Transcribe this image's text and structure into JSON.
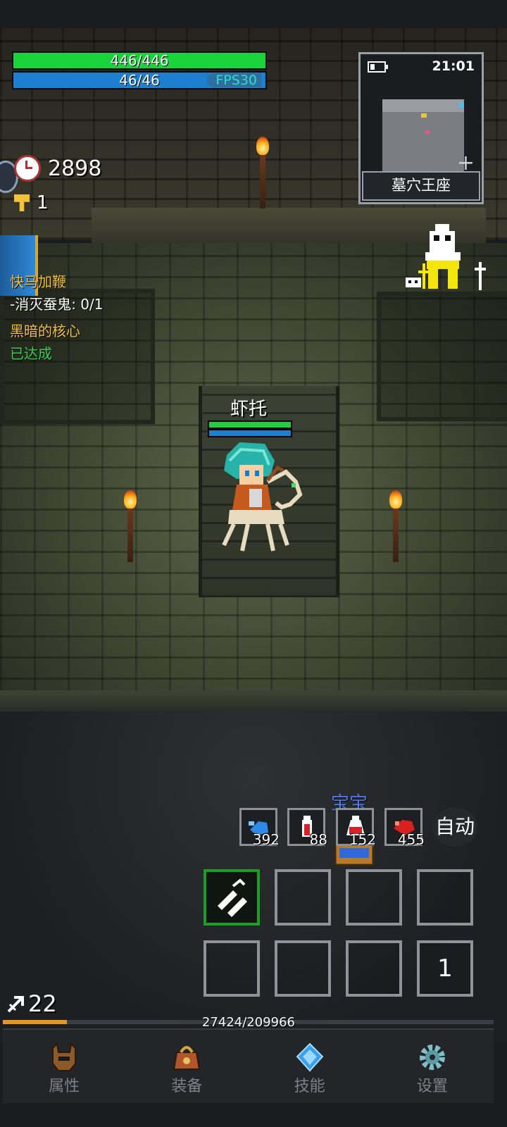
{
  "hud": {
    "hp_text": "446/446",
    "mp_text": "46/46",
    "fps_text": "FPS30",
    "time_counter": "2898",
    "keys": "1"
  },
  "minimap": {
    "clock": "21:01",
    "location": "墓穴王座",
    "zoom_label": "+"
  },
  "quest": {
    "title": "快马加鞭",
    "objective": "-消灭蚕鬼: 0/1",
    "goal": "黑暗的核心",
    "status": "已达成"
  },
  "player": {
    "name": "虾托",
    "hp_fraction": 1.0,
    "mp_fraction": 1.0
  },
  "pet": {
    "name": "宝宝"
  },
  "consumables": [
    {
      "icon": "blue-mana-potion-icon",
      "count": "392"
    },
    {
      "icon": "red-health-potion-icon",
      "count": "88"
    },
    {
      "icon": "elixir-potion-icon",
      "count": "152"
    },
    {
      "icon": "red-meat-icon",
      "count": "455"
    }
  ],
  "auto_button": "自动",
  "skill_counter": "1",
  "level": {
    "value": "22",
    "xp_text": "27424/209966",
    "xp_fraction": 0.1306
  },
  "nav": {
    "items": [
      {
        "label": "属性",
        "icon": "helmet-icon"
      },
      {
        "label": "装备",
        "icon": "bag-icon"
      },
      {
        "label": "技能",
        "icon": "crystal-icon"
      },
      {
        "label": "设置",
        "icon": "gear-icon"
      }
    ]
  },
  "colors": {
    "hp": "#18d33a",
    "mp": "#1d7fd0",
    "quest_yellow": "#f0c040",
    "quest_green": "#34d24a",
    "pet_blue": "#4a7cf0",
    "xp": "#e0982a"
  }
}
